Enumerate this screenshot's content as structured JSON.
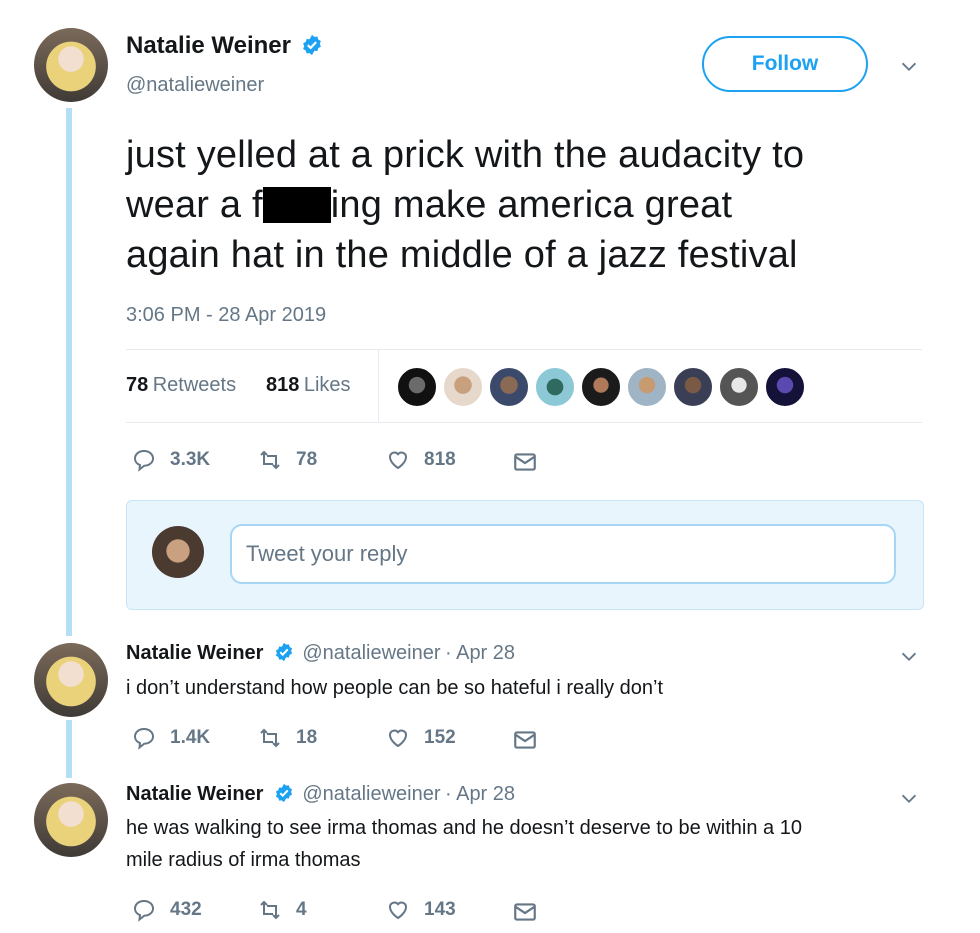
{
  "main_tweet": {
    "author_name": "Natalie Weiner",
    "author_handle": "@natalieweiner",
    "follow_label": "Follow",
    "text_line1": "just yelled at a prick with the audacity to",
    "text_line2_before": "wear a f",
    "text_line2_after": "ing make america great",
    "text_line3": "again hat in the middle of a jazz festival",
    "timestamp": "3:06 PM - 28 Apr 2019",
    "retweets_count": "78",
    "retweets_label": "Retweets",
    "likes_count": "818",
    "likes_label": "Likes",
    "actions": {
      "replies": "3.3K",
      "retweets": "78",
      "likes": "818"
    }
  },
  "reply_box": {
    "placeholder": "Tweet your reply"
  },
  "replies": [
    {
      "author_name": "Natalie Weiner",
      "author_handle": "@natalieweiner",
      "date": "· Apr 28",
      "text_line1": "i don’t understand how people can be so hateful i really don’t",
      "text_line2": "",
      "actions": {
        "replies": "1.4K",
        "retweets": "18",
        "likes": "152"
      }
    },
    {
      "author_name": "Natalie Weiner",
      "author_handle": "@natalieweiner",
      "date": "· Apr 28",
      "text_line1": "he was walking to see irma thomas and he doesn’t deserve to be within a 10",
      "text_line2": "mile radius of irma thomas",
      "actions": {
        "replies": "432",
        "retweets": "4",
        "likes": "143"
      }
    }
  ],
  "colors": {
    "accent": "#1da1f2",
    "muted": "#657786",
    "text": "#14171a",
    "thread_line": "#b5dff5"
  }
}
